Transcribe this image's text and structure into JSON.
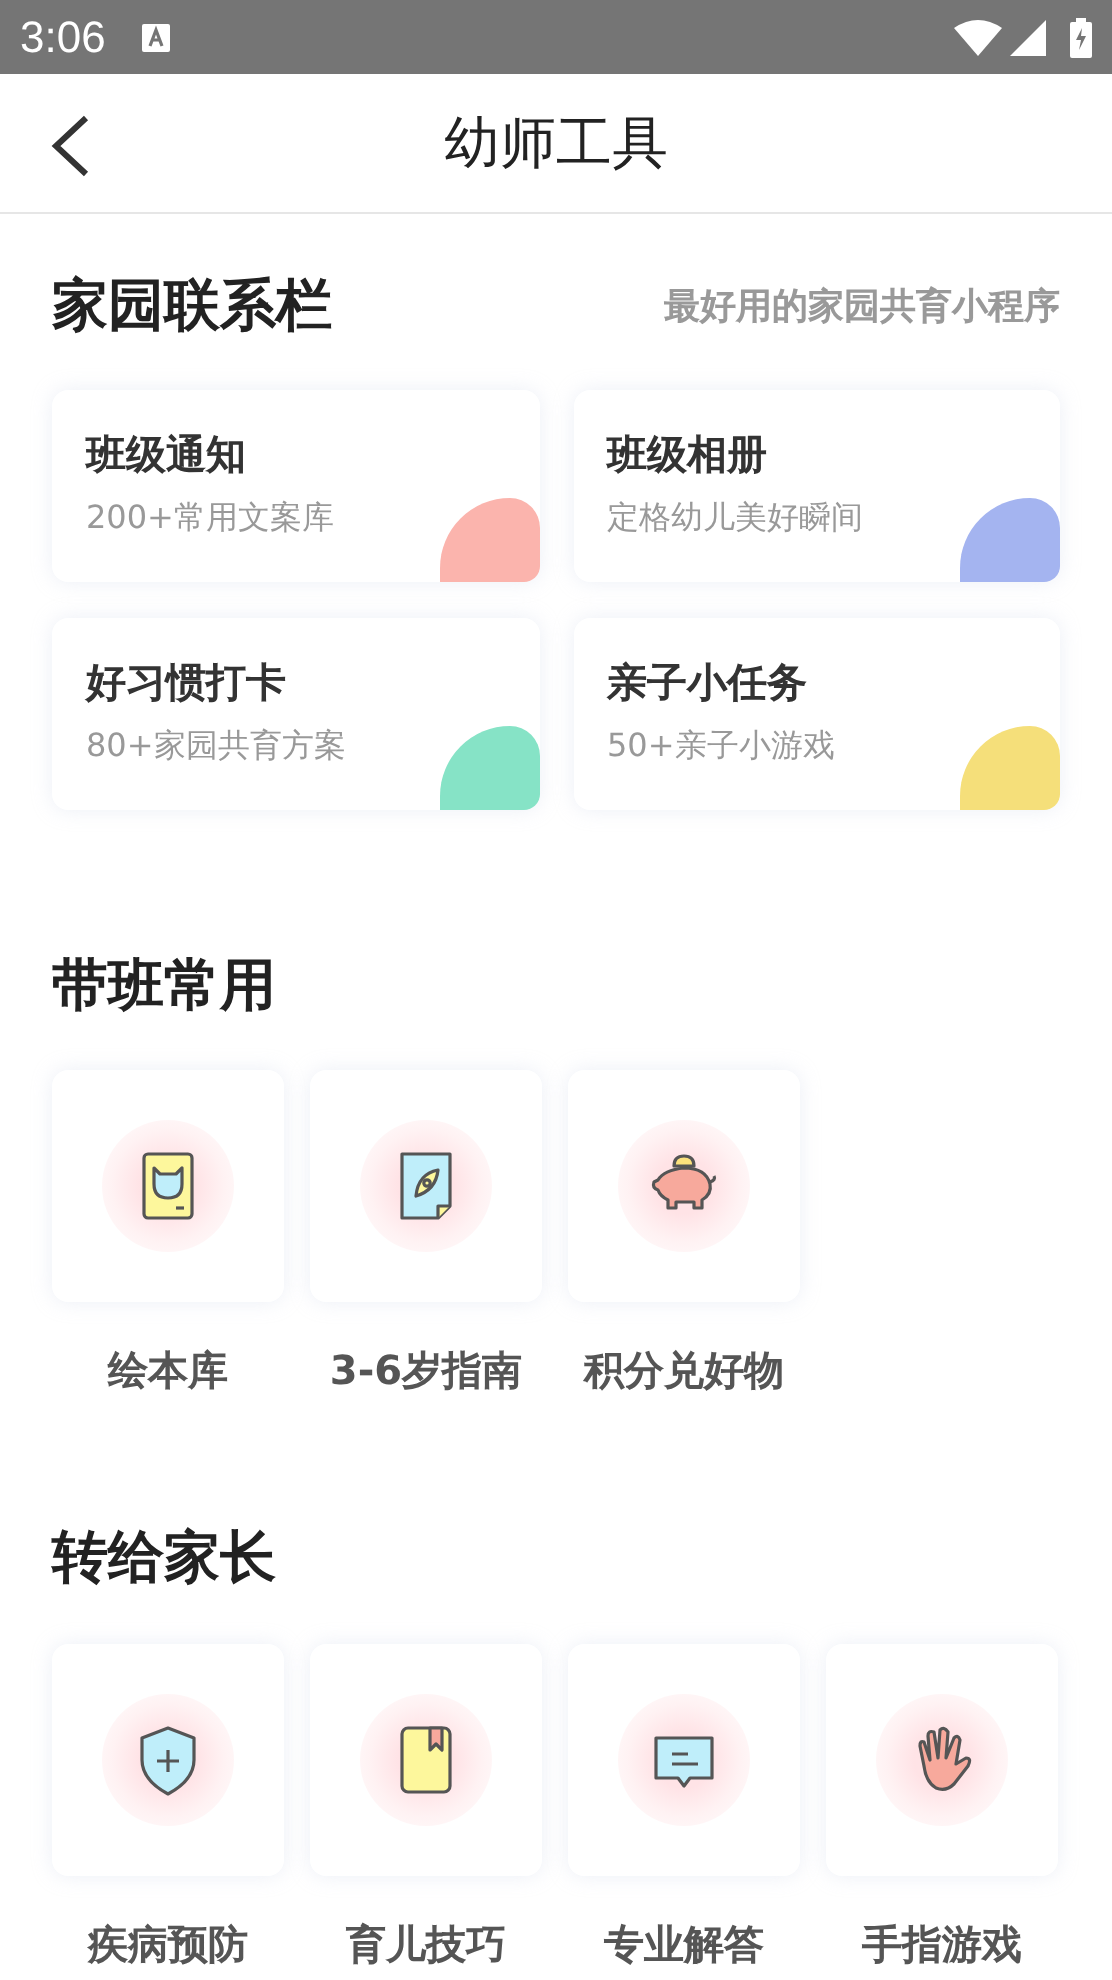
{
  "status_bar": {
    "time": "3:06"
  },
  "header": {
    "title": "幼师工具"
  },
  "home_school": {
    "title": "家园联系栏",
    "subtitle": "最好用的家园共育小程序",
    "cards": [
      {
        "title": "班级通知",
        "description": "200+常用文案库",
        "color": "#fbb4ad"
      },
      {
        "title": "班级相册",
        "description": "定格幼儿美好瞬间",
        "color": "#a4b4f0"
      },
      {
        "title": "好习惯打卡",
        "description": "80+家园共育方案",
        "color": "#86e3c6"
      },
      {
        "title": "亲子小任务",
        "description": "50+亲子小游戏",
        "color": "#f5df7a"
      }
    ]
  },
  "class_tools": {
    "title": "带班常用",
    "items": [
      {
        "label": "绘本库",
        "kind": "picture_book"
      },
      {
        "label": "3-6岁指南",
        "kind": "guide"
      },
      {
        "label": "积分兑好物",
        "kind": "piggy"
      }
    ]
  },
  "for_parents": {
    "title": "转给家长",
    "items": [
      {
        "label": "疾病预防",
        "kind": "shield"
      },
      {
        "label": "育儿技巧",
        "kind": "book"
      },
      {
        "label": "专业解答",
        "kind": "message"
      },
      {
        "label": "手指游戏",
        "kind": "hand"
      }
    ]
  }
}
